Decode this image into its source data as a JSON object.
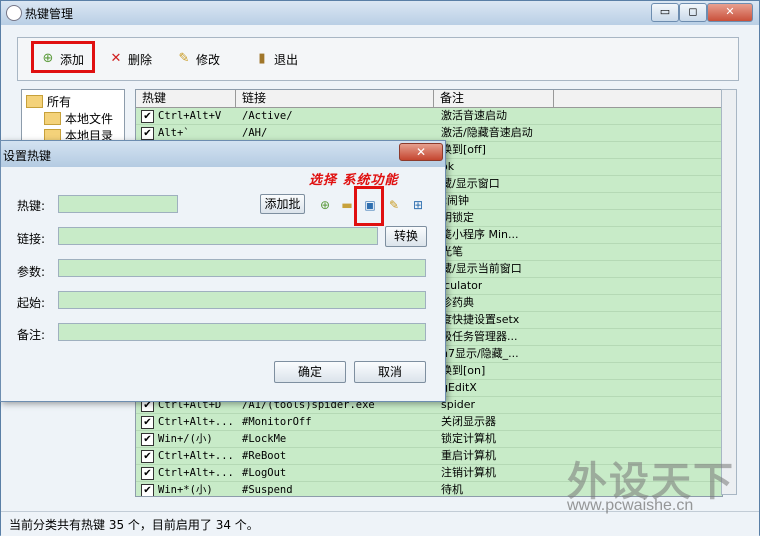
{
  "main": {
    "title": "热键管理",
    "titlebar_buttons": {
      "minimize": "▭",
      "maximize": "◻",
      "close": "✕"
    },
    "toolbar": {
      "add": "添加",
      "delete": "删除",
      "edit": "修改",
      "exit": "退出"
    },
    "tree": {
      "items": [
        "所有",
        "本地文件",
        "本地目录"
      ]
    },
    "grid": {
      "headers": [
        "热键",
        "链接",
        "备注"
      ],
      "rows": [
        {
          "hotkey": "Ctrl+Alt+V",
          "link": "/Active/",
          "note": "激活音速启动"
        },
        {
          "hotkey": "Alt+`",
          "link": "/AH/",
          "note": "激活/隐藏音速启动"
        },
        {
          "hotkey": "",
          "link": "",
          "note": "换到[off]"
        },
        {
          "hotkey": "",
          "link": "",
          "note": "ok"
        },
        {
          "hotkey": "",
          "link": "",
          "note": "藏/显示窗口"
        },
        {
          "hotkey": "",
          "link": "",
          "note": "c闹钟"
        },
        {
          "hotkey": "",
          "link": "",
          "note": "明锁定"
        },
        {
          "hotkey": "",
          "link": "",
          "note": "笺小程序 Min..."
        },
        {
          "hotkey": "",
          "link": "",
          "note": "光笔"
        },
        {
          "hotkey": "",
          "link": "",
          "note": "藏/显示当前窗口"
        },
        {
          "hotkey": "",
          "link": "",
          "note": "lculator"
        },
        {
          "hotkey": "",
          "link": "",
          "note": "珍药典"
        },
        {
          "hotkey": "",
          "link": "",
          "note": "度快捷设置setx"
        },
        {
          "hotkey": "",
          "link": "",
          "note": "级任务管理器..."
        },
        {
          "hotkey": "",
          "link": "",
          "note": "n7显示/隐藏_..."
        },
        {
          "hotkey": "",
          "link": "",
          "note": "换到[on]"
        },
        {
          "hotkey": "",
          "link": "",
          "note": "gEditX"
        },
        {
          "hotkey": "Ctrl+Alt+D",
          "link": "/A1/(tools)spider.exe",
          "note": "spider"
        },
        {
          "hotkey": "Ctrl+Alt+...",
          "link": "#MonitorOff",
          "note": "关闭显示器"
        },
        {
          "hotkey": "Win+/(小)",
          "link": "#LockMe",
          "note": "锁定计算机"
        },
        {
          "hotkey": "Ctrl+Alt+...",
          "link": "#ReBoot",
          "note": "重启计算机"
        },
        {
          "hotkey": "Ctrl+Alt+...",
          "link": "#LogOut",
          "note": "注销计算机"
        },
        {
          "hotkey": "Win+*(小)",
          "link": "#Suspend",
          "note": "待机"
        }
      ]
    },
    "status": "当前分类共有热键 35 个，目前启用了 34 个。",
    "watermark": "外设天下",
    "watermark_url": "www.pcwaishe.cn"
  },
  "dialog": {
    "title": "设置热键",
    "close": "✕",
    "labels": {
      "hotkey": "热键:",
      "link": "链接:",
      "params": "参数:",
      "start": "起始:",
      "note": "备注:"
    },
    "add_batch": "添加批",
    "convert": "转换",
    "ok": "确定",
    "cancel": "取消",
    "annotation": "选择 系统功能"
  },
  "colors": {
    "highlight": "#e01010",
    "grid_bg": "#c8ebc8"
  }
}
